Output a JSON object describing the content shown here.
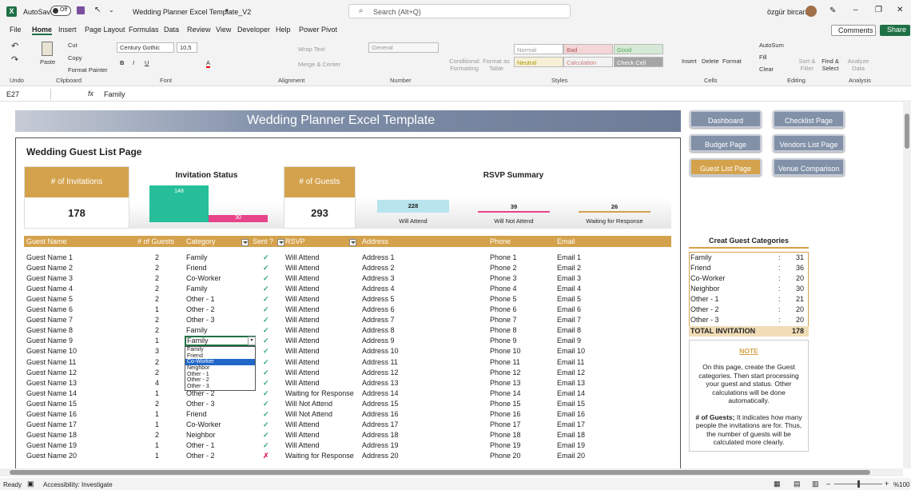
{
  "titlebar": {
    "autosave_label": "AutoSave",
    "autosave_state": "Off",
    "doc_title": "Wedding Planner Excel Template_V2",
    "search_placeholder": "Search (Alt+Q)",
    "user_name": "özgür bircan"
  },
  "menu": {
    "tabs": [
      "File",
      "Home",
      "Insert",
      "Page Layout",
      "Formulas",
      "Data",
      "Review",
      "View",
      "Developer",
      "Help",
      "Power Pivot"
    ],
    "comments": "Comments",
    "share": "Share"
  },
  "ribbon": {
    "undo_label": "Undo",
    "clipboard": {
      "paste": "Paste",
      "cut": "Cut",
      "copy": "Copy",
      "format_painter": "Format Painter",
      "label": "Clipboard"
    },
    "font": {
      "name": "Century Gothic",
      "size": "10,5",
      "label": "Font"
    },
    "alignment": {
      "wrap": "Wrap Text",
      "merge": "Merge & Center",
      "label": "Alignment"
    },
    "number": {
      "format": "General",
      "label": "Number"
    },
    "styles": {
      "cond": "Conditional Formatting",
      "table": "Format as Table",
      "normal": "Normal",
      "bad": "Bad",
      "good": "Good",
      "neutral": "Neutral",
      "calculation": "Calculation",
      "check": "Check Cell",
      "label": "Styles"
    },
    "cells": {
      "insert": "Insert",
      "delete": "Delete",
      "format": "Format",
      "label": "Cells"
    },
    "editing": {
      "autosum": "AutoSum",
      "fill": "Fill",
      "clear": "Clear",
      "sort": "Sort & Filter",
      "find": "Find & Select",
      "label": "Editing"
    },
    "analysis": {
      "analyze": "Analyze Data",
      "label": "Analysis"
    }
  },
  "formula": {
    "cell_ref": "E27",
    "value": "Family"
  },
  "sheet": {
    "title": "Wedding Planner Excel Template",
    "page_title": "Wedding Guest List Page",
    "nav_buttons": [
      "Dashboard",
      "Checklist Page",
      "Budget Page",
      "Vendors List Page",
      "Guest List Page",
      "Venue Comparison"
    ],
    "invitations": {
      "label": "# of Invitations",
      "value": "178"
    },
    "invitation_status": {
      "title": "Invitation Status",
      "bar1": 148,
      "bar2": 30
    },
    "guests": {
      "label": "# of Guests",
      "value": "293"
    },
    "rsvp": {
      "title": "RSVP Summary",
      "attend": 228,
      "not_attend": 39,
      "waiting": 26,
      "attend_label": "Will Attend",
      "not_attend_label": "Will Not Attend",
      "waiting_label": "Waiting for Response"
    },
    "headers": [
      "Guest Name",
      "# of Guests",
      "Category",
      "Sent ?",
      "RSVP",
      "Address",
      "Phone",
      "Email"
    ],
    "rows": [
      [
        "Guest Name 1",
        "2",
        "Family",
        "✓",
        "Will Attend",
        "Address 1",
        "Phone 1",
        "Email 1"
      ],
      [
        "Guest Name 2",
        "2",
        "Friend",
        "✓",
        "Will Attend",
        "Address 2",
        "Phone 2",
        "Email 2"
      ],
      [
        "Guest Name 3",
        "2",
        "Co-Worker",
        "✓",
        "Will Attend",
        "Address 3",
        "Phone 3",
        "Email 3"
      ],
      [
        "Guest Name 4",
        "2",
        "Family",
        "✓",
        "Will Attend",
        "Address 4",
        "Phone 4",
        "Email 4"
      ],
      [
        "Guest Name 5",
        "2",
        "Other - 1",
        "✓",
        "Will Attend",
        "Address 5",
        "Phone 5",
        "Email 5"
      ],
      [
        "Guest Name 6",
        "1",
        "Other - 2",
        "✓",
        "Will Attend",
        "Address 6",
        "Phone 6",
        "Email 6"
      ],
      [
        "Guest Name 7",
        "2",
        "Other - 3",
        "✓",
        "Will Attend",
        "Address 7",
        "Phone 7",
        "Email 7"
      ],
      [
        "Guest Name 8",
        "2",
        "Family",
        "✓",
        "Will Attend",
        "Address 8",
        "Phone 8",
        "Email 8"
      ],
      [
        "Guest Name 9",
        "1",
        "Family",
        "✓",
        "Will Attend",
        "Address 9",
        "Phone 9",
        "Email 9"
      ],
      [
        "Guest Name 10",
        "3",
        "",
        "✓",
        "Will Attend",
        "Address 10",
        "Phone 10",
        "Email 10"
      ],
      [
        "Guest Name 11",
        "2",
        "",
        "✓",
        "Will Attend",
        "Address 11",
        "Phone 11",
        "Email 11"
      ],
      [
        "Guest Name 12",
        "2",
        "",
        "✓",
        "Will Attend",
        "Address 12",
        "Phone 12",
        "Email 12"
      ],
      [
        "Guest Name 13",
        "4",
        "",
        "✓",
        "Will Attend",
        "Address 13",
        "Phone 13",
        "Email 13"
      ],
      [
        "Guest Name 14",
        "1",
        "Other - 2",
        "✓",
        "Waiting for Response",
        "Address 14",
        "Phone 14",
        "Email 14"
      ],
      [
        "Guest Name 15",
        "2",
        "Other - 3",
        "✓",
        "Will Not Attend",
        "Address 15",
        "Phone 15",
        "Email 15"
      ],
      [
        "Guest Name 16",
        "1",
        "Friend",
        "✓",
        "Will Not Attend",
        "Address 16",
        "Phone 16",
        "Email 16"
      ],
      [
        "Guest Name 17",
        "1",
        "Co-Worker",
        "✓",
        "Will Attend",
        "Address 17",
        "Phone 17",
        "Email 17"
      ],
      [
        "Guest Name 18",
        "2",
        "Neighbor",
        "✓",
        "Will Attend",
        "Address 18",
        "Phone 18",
        "Email 18"
      ],
      [
        "Guest Name 19",
        "1",
        "Other - 1",
        "✓",
        "Will Attend",
        "Address 19",
        "Phone 19",
        "Email 19"
      ],
      [
        "Guest Name 20",
        "1",
        "Other - 2",
        "✗",
        "Waiting for Response",
        "Address 20",
        "Phone 20",
        "Email 20"
      ]
    ],
    "dropdown": [
      "Family",
      "Friend",
      "Co-Worker",
      "Neighbor",
      "Other - 1",
      "Other - 2",
      "Other - 3"
    ],
    "dropdown_selected": 2,
    "categories_title": "Creat Guest Categories",
    "categories": [
      [
        "Family",
        "31"
      ],
      [
        "Friend",
        "36"
      ],
      [
        "Co-Worker",
        "20"
      ],
      [
        "Neighbor",
        "30"
      ],
      [
        "Other - 1",
        "21"
      ],
      [
        "Other - 2",
        "20"
      ],
      [
        "Other - 3",
        "20"
      ]
    ],
    "total": [
      "TOTAL INVITATION",
      "178"
    ],
    "note_title": "NOTE",
    "note_text1": "On this page, create the Guest categories. Then start processing your guest and status. Other calculations will be done automatically.",
    "note_text2_bold": "# of Guests;",
    "note_text2": " It indicates how many people the invitations are for. Thus, the number of guests will be calculated more clearly."
  },
  "status": {
    "ready": "Ready",
    "accessibility": "Accessibility: Investigate",
    "zoom": "%100"
  },
  "colors": {
    "gold": "#d4a24c",
    "teal": "#26bf9a",
    "pink": "#e8448a",
    "slate": "#7f8ea8"
  }
}
